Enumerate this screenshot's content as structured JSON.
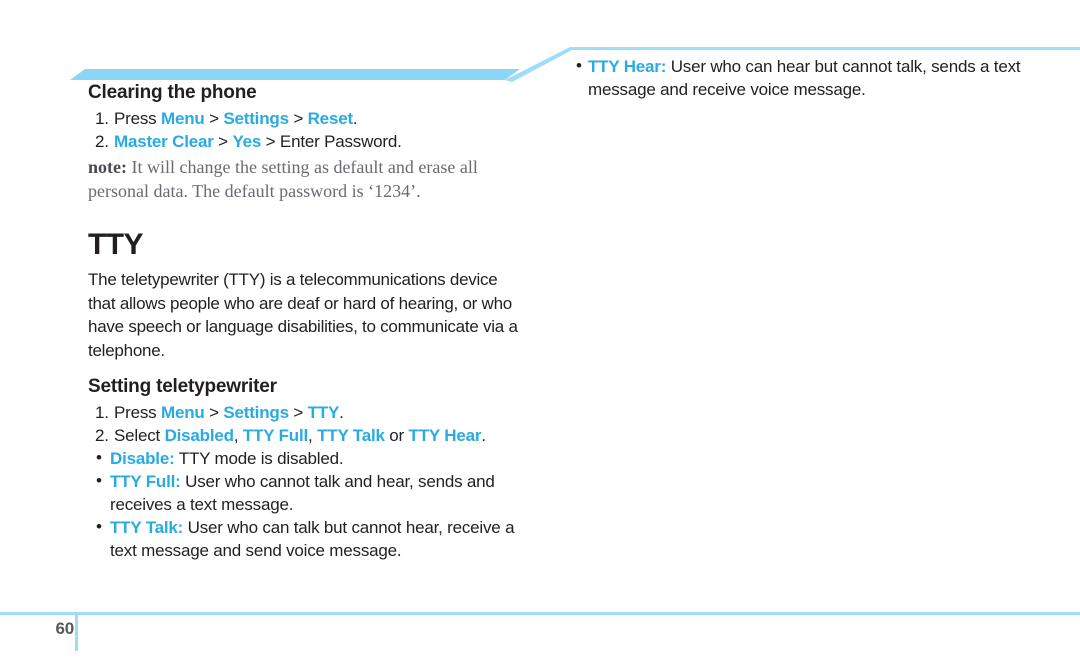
{
  "page": {
    "number": "60",
    "accent_color": "#29abe2",
    "banner_light_color": "#9fdcf7",
    "banner_solid_color": "#8bd6f5",
    "text_color": "#231f20",
    "note_color": "#6a6a72"
  },
  "left_column": {
    "clearing": {
      "heading": "Clearing the phone",
      "steps": [
        {
          "num": "1.",
          "parts": [
            {
              "text": "Press ",
              "style": "plain"
            },
            {
              "text": "Menu",
              "style": "accent"
            },
            {
              "text": " > ",
              "style": "plain"
            },
            {
              "text": "Settings",
              "style": "accent"
            },
            {
              "text": " > ",
              "style": "plain"
            },
            {
              "text": "Reset",
              "style": "accent"
            },
            {
              "text": ".",
              "style": "plain"
            }
          ]
        },
        {
          "num": "2.",
          "parts": [
            {
              "text": "Master Clear",
              "style": "accent"
            },
            {
              "text": " > ",
              "style": "plain"
            },
            {
              "text": "Yes",
              "style": "accent"
            },
            {
              "text": " > Enter Password.",
              "style": "plain"
            }
          ]
        }
      ],
      "note_label": "note:",
      "note_text": " It will change the setting as default and erase all personal data. The default password is ‘1234’."
    },
    "tty": {
      "heading": "TTY",
      "body": "The teletypewriter (TTY) is a telecommunications device that allows people who are deaf or hard of hearing, or who have speech or language disabilities, to communicate via a telephone."
    },
    "setting": {
      "heading": "Setting teletypewriter",
      "steps": [
        {
          "num": "1.",
          "parts": [
            {
              "text": "Press ",
              "style": "plain"
            },
            {
              "text": "Menu",
              "style": "accent"
            },
            {
              "text": " > ",
              "style": "plain"
            },
            {
              "text": "Settings",
              "style": "accent"
            },
            {
              "text": " > ",
              "style": "plain"
            },
            {
              "text": "TTY",
              "style": "accent"
            },
            {
              "text": ".",
              "style": "plain"
            }
          ]
        },
        {
          "num": "2.",
          "parts": [
            {
              "text": "Select ",
              "style": "plain"
            },
            {
              "text": "Disabled",
              "style": "accent"
            },
            {
              "text": ", ",
              "style": "plain"
            },
            {
              "text": "TTY Full",
              "style": "accent"
            },
            {
              "text": ", ",
              "style": "plain"
            },
            {
              "text": "TTY Talk",
              "style": "accent"
            },
            {
              "text": " or ",
              "style": "plain"
            },
            {
              "text": "TTY Hear",
              "style": "accent"
            },
            {
              "text": ".",
              "style": "plain"
            }
          ]
        }
      ],
      "bullets": [
        {
          "term": "Disable:",
          "desc": " TTY mode is disabled."
        },
        {
          "term": "TTY Full:",
          "desc": " User who cannot talk and hear, sends and receives a text message."
        },
        {
          "term": "TTY Talk:",
          "desc": " User who can talk but cannot hear, receive a text message and send voice message."
        }
      ]
    }
  },
  "right_column": {
    "bullets": [
      {
        "term": "TTY Hear:",
        "desc": " User who can hear but cannot talk, sends a text message and receive voice message."
      }
    ]
  }
}
